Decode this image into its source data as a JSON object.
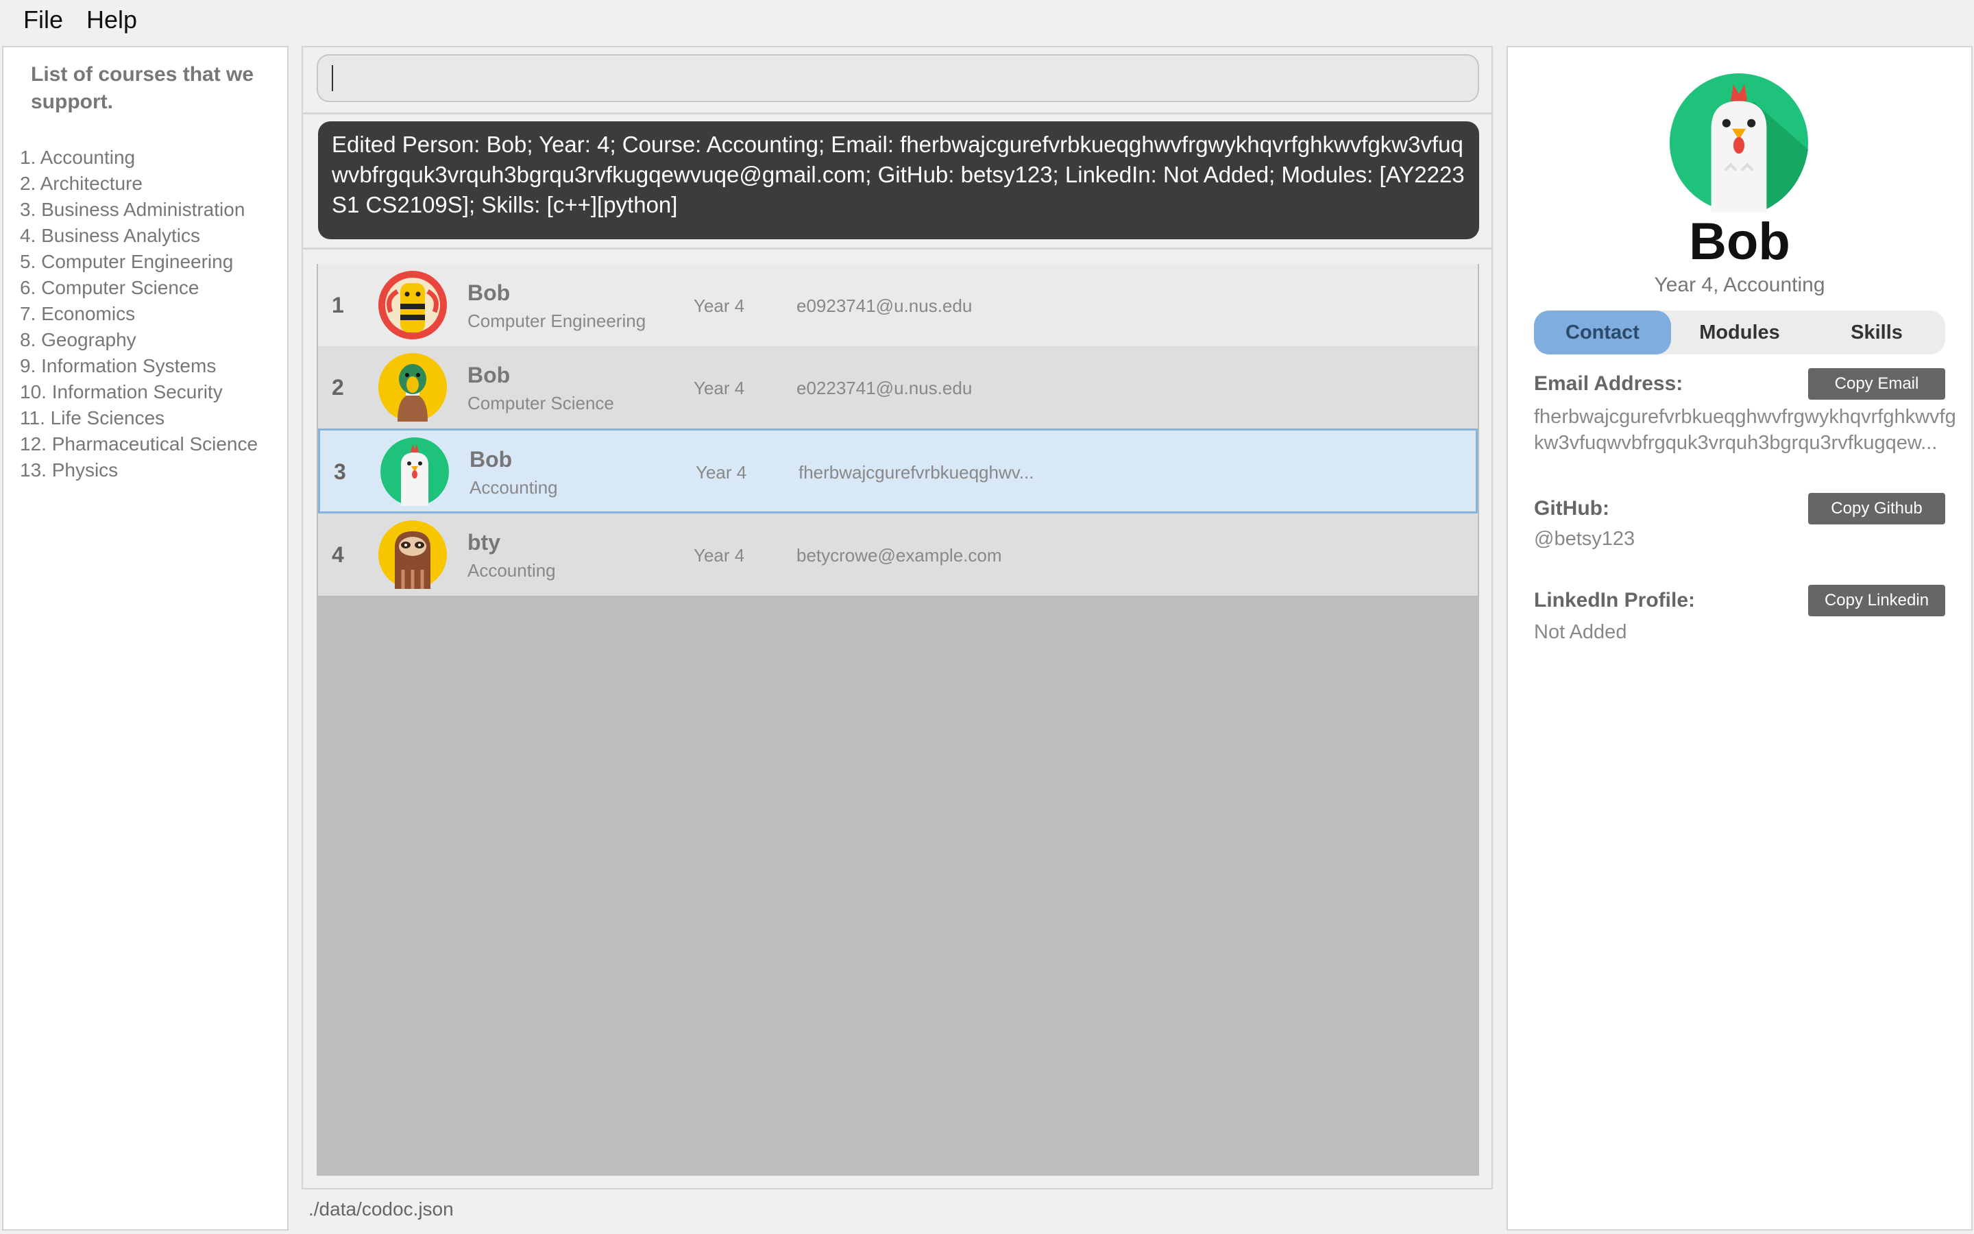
{
  "menu": {
    "file": "File",
    "help": "Help"
  },
  "sidebar": {
    "title": "List of courses that we support.",
    "courses": [
      "1. Accounting",
      "2. Architecture",
      "3. Business Administration",
      "4. Business Analytics",
      "5. Computer Engineering",
      "6. Computer Science",
      "7. Economics",
      "8. Geography",
      "9. Information Systems",
      "10. Information Security",
      "11. Life Sciences",
      "12. Pharmaceutical Science",
      "13. Physics"
    ]
  },
  "command": {
    "value": "",
    "placeholder": ""
  },
  "result": {
    "text": "Edited Person: Bob; Year: 4; Course: Accounting; Email: fherbwajcgurefvrbkueqghwvfrgwykhqvrfghkwvfgkw3vfuqwvbfrgquk3vrquh3bgrqu3rvfkugqewvuqe@gmail.com; GitHub: betsy123; LinkedIn: Not Added; Modules: [AY2223S1 CS2109S]; Skills: [c++][python]"
  },
  "persons": [
    {
      "index": "1",
      "name": "Bob",
      "course": "Computer Engineering",
      "year": "Year 4",
      "email": "e0923741@u.nus.edu",
      "avatar_icon": "bee-icon"
    },
    {
      "index": "2",
      "name": "Bob",
      "course": "Computer Science",
      "year": "Year 4",
      "email": "e0223741@u.nus.edu",
      "avatar_icon": "duck-icon"
    },
    {
      "index": "3",
      "name": "Bob",
      "course": "Accounting",
      "year": "Year 4",
      "email": "fherbwajcgurefvrbkueqghwv...",
      "avatar_icon": "chicken-icon",
      "selected": true
    },
    {
      "index": "4",
      "name": "bty",
      "course": "Accounting",
      "year": "Year 4",
      "email": "betycrowe@example.com",
      "avatar_icon": "sloth-icon"
    }
  ],
  "status": {
    "path": "./data/codoc.json"
  },
  "profile": {
    "name": "Bob",
    "subtitle": "Year 4, Accounting",
    "avatar_icon": "chicken-icon",
    "tabs": [
      "Contact",
      "Modules",
      "Skills"
    ],
    "active_tab": "Contact",
    "email_label": "Email Address:",
    "email_value": "fherbwajcgurefvrbkueqghwvfrgwykhqvrfghkwvfgkw3vfuqwvbfrgquk3vrquh3bgrqu3rvfkugqew...",
    "copy_email": "Copy Email",
    "github_label": "GitHub:",
    "github_value": "@betsy123",
    "copy_github": "Copy Github",
    "linkedin_label": "LinkedIn Profile:",
    "linkedin_value": "Not Added",
    "copy_linkedin": "Copy Linkedin"
  },
  "colors": {
    "selected_row": "#d8e8f6",
    "selected_border": "#86b3de",
    "active_tab": "#7eadde",
    "result_bg": "#3c3c3c",
    "button_bg": "#666666"
  }
}
